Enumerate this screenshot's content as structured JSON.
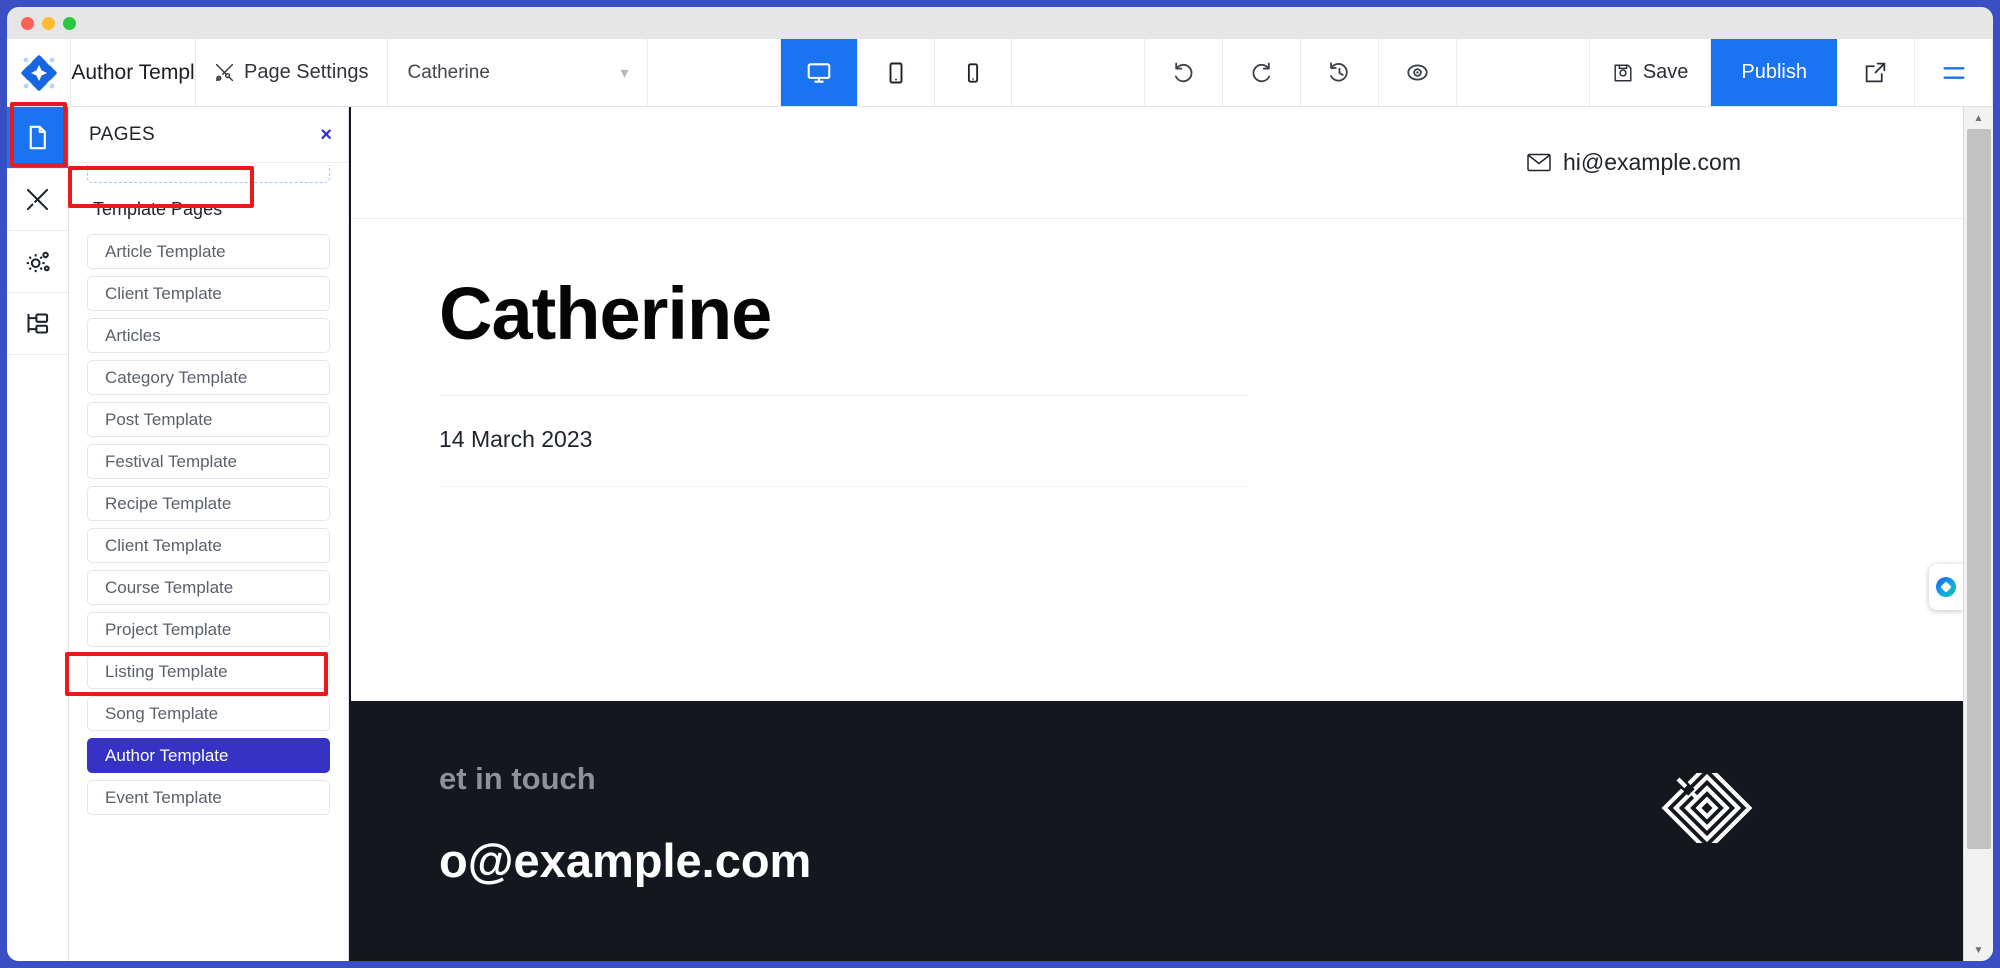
{
  "window": {
    "traffic_lights": [
      "close",
      "minimize",
      "maximize"
    ]
  },
  "toolbar": {
    "app_title": "Author Templ",
    "page_settings_label": "Page Settings",
    "current_page_name": "Catherine",
    "chevron": "∨",
    "devices": [
      {
        "name": "desktop",
        "label": "Desktop",
        "active": true
      },
      {
        "name": "tablet",
        "label": "Tablet",
        "active": false
      },
      {
        "name": "mobile",
        "label": "Mobile",
        "active": false
      }
    ],
    "actions": [
      {
        "name": "undo",
        "label": "Undo"
      },
      {
        "name": "redo",
        "label": "Redo"
      },
      {
        "name": "history",
        "label": "Revision History"
      },
      {
        "name": "preview",
        "label": "Preview"
      }
    ],
    "save_label": "Save",
    "publish_label": "Publish",
    "open_external_label": "Open in new tab",
    "menu_label": "Menu",
    "accent_blue": "#1a73f0"
  },
  "icon_rail": [
    {
      "name": "pages",
      "label": "Pages",
      "active": true
    },
    {
      "name": "design",
      "label": "Design"
    },
    {
      "name": "settings",
      "label": "Settings"
    },
    {
      "name": "structure",
      "label": "Structure"
    }
  ],
  "pages_panel": {
    "title": "PAGES",
    "close_label": "×",
    "section_title": "Template Pages",
    "selected_color": "#3532c4",
    "items": [
      {
        "label": "Article Template",
        "selected": false
      },
      {
        "label": "Client Template",
        "selected": false
      },
      {
        "label": "Articles",
        "selected": false
      },
      {
        "label": "Category Template",
        "selected": false
      },
      {
        "label": "Post Template",
        "selected": false
      },
      {
        "label": "Festival Template",
        "selected": false
      },
      {
        "label": "Recipe Template",
        "selected": false
      },
      {
        "label": "Client Template",
        "selected": false
      },
      {
        "label": "Course Template",
        "selected": false
      },
      {
        "label": "Project Template",
        "selected": false
      },
      {
        "label": "Listing Template",
        "selected": false
      },
      {
        "label": "Song Template",
        "selected": false
      },
      {
        "label": "Author Template",
        "selected": true
      },
      {
        "label": "Event Template",
        "selected": false
      }
    ]
  },
  "preview": {
    "header_email": "hi@example.com",
    "hero_title": "Catherine",
    "hero_date": "14 March 2023",
    "footer_kicker": "et in touch",
    "footer_email": "o@example.com",
    "footer_bg": "#15171f"
  },
  "annotations": {
    "color": "#e81b1b",
    "boxes": [
      {
        "name": "pages-rail-icon-highlight"
      },
      {
        "name": "template-pages-heading-highlight"
      },
      {
        "name": "author-template-item-highlight"
      }
    ]
  },
  "scrollbar": {
    "up_arrow": "▲",
    "down_arrow": "▼"
  },
  "chat_widget": {
    "label": "Chat widget"
  }
}
